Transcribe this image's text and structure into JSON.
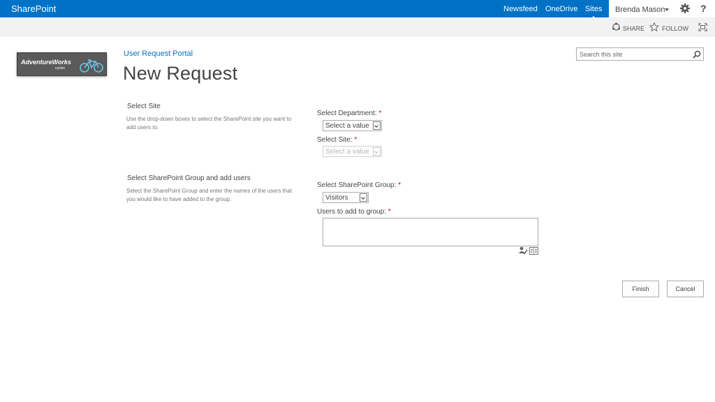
{
  "suitebar": {
    "brand": "SharePoint",
    "links": [
      "Newsfeed",
      "OneDrive",
      "Sites"
    ],
    "active_link": "Sites",
    "user_name": "Brenda Mason",
    "help_label": "?",
    "color": "#0072c6"
  },
  "ribbon": {
    "share_label": "SHARE",
    "follow_label": "FOLLOW"
  },
  "logo": {
    "text": "AdventureWorks",
    "subtext": "cycles"
  },
  "breadcrumb": "User Request Portal",
  "page_title": "New Request",
  "search": {
    "placeholder": "Search this site"
  },
  "sections": {
    "site": {
      "title": "Select Site",
      "description": "Use the drop-down boxes to select the SharePoint site you want to add users to.",
      "department_label": "Select Department:",
      "department_value": "Select a value",
      "site_label": "Select Site:",
      "site_value": "Select a value"
    },
    "group": {
      "title": "Select SharePoint Group and add users",
      "description": "Select the SharePoint Group and enter the names of the users that you would like to have added to the group.",
      "group_label": "Select SharePoint Group:",
      "group_value": "Visitors",
      "users_label": "Users to add to group:",
      "users_value": ""
    },
    "required_marker": "*"
  },
  "buttons": {
    "finish": "Finish",
    "cancel": "Cancel"
  }
}
